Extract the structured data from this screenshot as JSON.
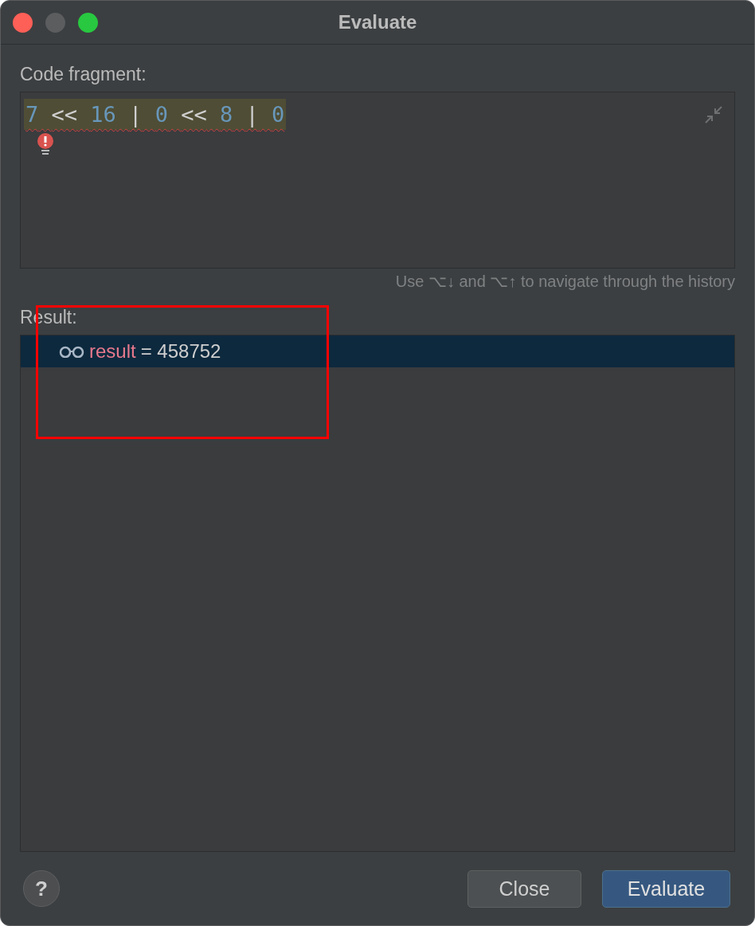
{
  "window": {
    "title": "Evaluate",
    "buttons": [
      {
        "kind": "close",
        "disabled": false
      },
      {
        "kind": "minimize",
        "disabled": true
      },
      {
        "kind": "zoom",
        "disabled": false
      }
    ]
  },
  "code_fragment": {
    "label": "Code fragment:",
    "tokens": [
      {
        "kind": "number",
        "text": "7"
      },
      {
        "kind": "operator",
        "text": "<<"
      },
      {
        "kind": "number",
        "text": "16"
      },
      {
        "kind": "operator",
        "text": "|"
      },
      {
        "kind": "number",
        "text": "0"
      },
      {
        "kind": "operator",
        "text": "<<"
      },
      {
        "kind": "number",
        "text": "8"
      },
      {
        "kind": "operator",
        "text": "|"
      },
      {
        "kind": "number",
        "text": "0"
      }
    ],
    "has_error": true,
    "hint": "Use ⌥↓ and ⌥↑ to navigate through the history"
  },
  "result": {
    "label": "Result:",
    "rows": [
      {
        "name": "result",
        "value": "= 458752",
        "selected": true
      }
    ]
  },
  "highlight_box": {
    "kind": "rectangle"
  },
  "footer": {
    "help": "?",
    "buttons": [
      {
        "label": "Close",
        "kind": "secondary"
      },
      {
        "label": "Evaluate",
        "kind": "primary"
      }
    ]
  }
}
